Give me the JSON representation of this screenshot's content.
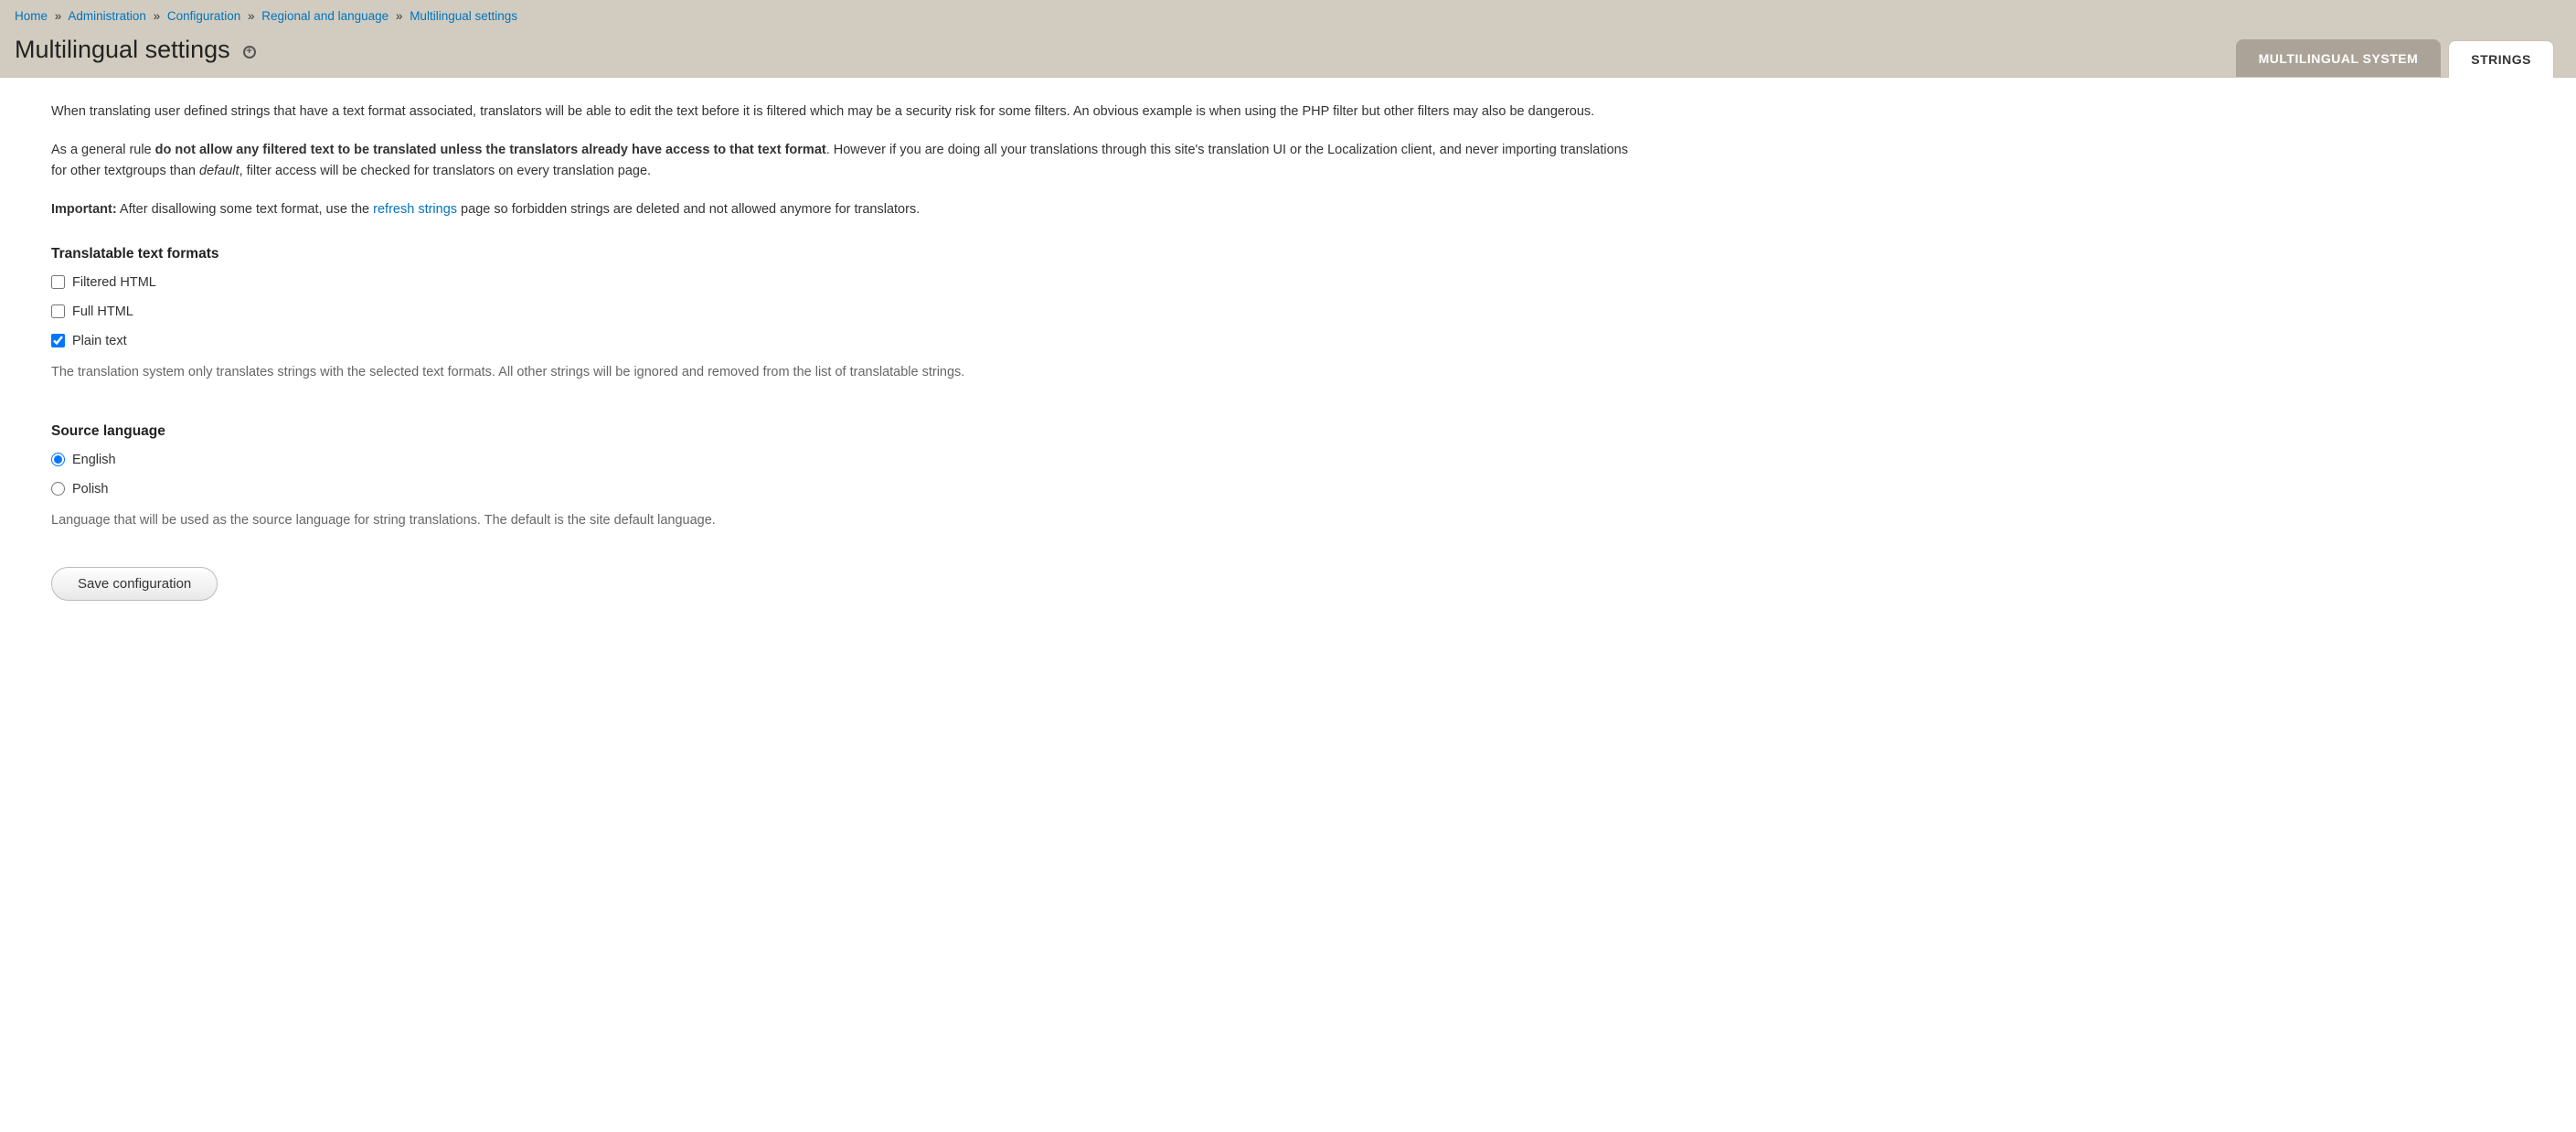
{
  "breadcrumb": {
    "items": [
      "Home",
      "Administration",
      "Configuration",
      "Regional and language",
      "Multilingual settings"
    ],
    "separator": "»"
  },
  "page_title": "Multilingual settings",
  "tabs": {
    "inactive": "MULTILINGUAL SYSTEM",
    "active": "STRINGS"
  },
  "intro": {
    "p1": "When translating user defined strings that have a text format associated, translators will be able to edit the text before it is filtered which may be a security risk for some filters. An obvious example is when using the PHP filter but other filters may also be dangerous.",
    "p2_pre": "As a general rule ",
    "p2_bold": "do not allow any filtered text to be translated unless the translators already have access to that text format",
    "p2_mid": ". However if you are doing all your translations through this site's translation UI or the Localization client, and never importing translations for other textgroups than ",
    "p2_em": "default",
    "p2_post": ", filter access will be checked for translators on every translation page.",
    "p3_bold": "Important:",
    "p3_pre": " After disallowing some text format, use the ",
    "p3_link": "refresh strings",
    "p3_post": " page so forbidden strings are deleted and not allowed anymore for translators."
  },
  "formats": {
    "title": "Translatable text formats",
    "options": [
      {
        "label": "Filtered HTML",
        "checked": false
      },
      {
        "label": "Full HTML",
        "checked": false
      },
      {
        "label": "Plain text",
        "checked": true
      }
    ],
    "description": "The translation system only translates strings with the selected text formats. All other strings will be ignored and removed from the list of translatable strings."
  },
  "source_language": {
    "title": "Source language",
    "options": [
      {
        "label": "English",
        "checked": true
      },
      {
        "label": "Polish",
        "checked": false
      }
    ],
    "description": "Language that will be used as the source language for string translations. The default is the site default language."
  },
  "submit_label": "Save configuration"
}
